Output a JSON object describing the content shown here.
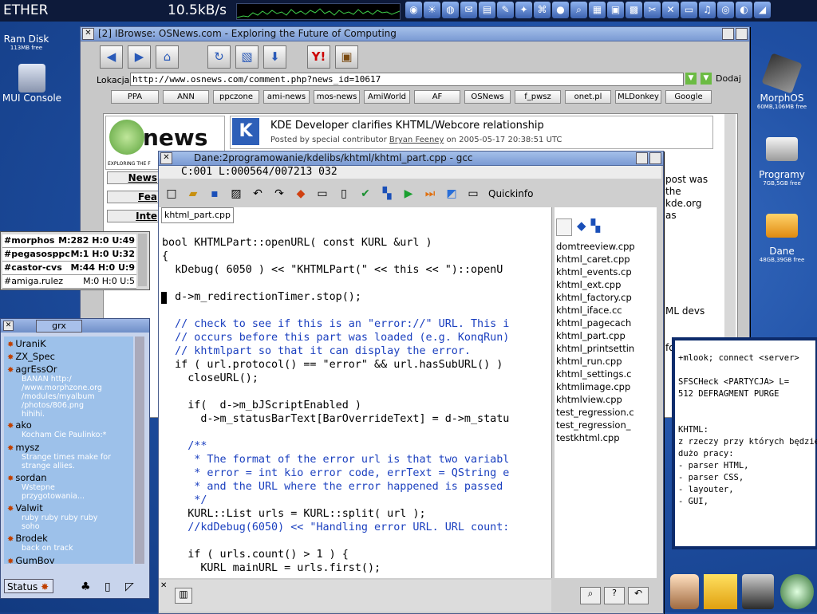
{
  "topbar": {
    "app_name": "ETHER",
    "rate": "10.5kB/s",
    "dock_icons": [
      "world-icon",
      "sun-icon",
      "globe-icon",
      "mail-icon",
      "note-icon",
      "paint-icon",
      "wand-icon",
      "net-icon",
      "bullet-icon",
      "magnifier-icon",
      "doc-icon",
      "calendar-icon",
      "image-icon",
      "tool-icon",
      "scissors-icon",
      "display-icon",
      "bell-icon",
      "disc-icon",
      "cd-icon",
      "flag-icon"
    ]
  },
  "desktop": {
    "ramdisk": {
      "label": "Ram Disk",
      "sub": "113MB free"
    },
    "mui": {
      "label": "MUI Console"
    },
    "morphos": {
      "label": "MorphOS",
      "sub": "60MB,106MB free"
    },
    "programy": {
      "label": "Programy",
      "sub": "7GB,5GB free"
    },
    "dane": {
      "label": "Dane",
      "sub": "48GB,39GB free"
    }
  },
  "ibrowse": {
    "title": "[2] IBrowse: OSNews.com - Exploring the Future of Computing",
    "location_label": "Lokacja:",
    "url": "http://www.osnews.com/comment.php?news_id=10617",
    "add_label": "Dodaj",
    "bookmarks": [
      "PPA",
      "ANN",
      "ppczone",
      "ami-news",
      "mos-news",
      "AmiWorld",
      "AF",
      "OSNews",
      "f_pwsz",
      "onet.pl",
      "MLDonkey",
      "Google"
    ],
    "headline": "KDE Developer clarifies KHTML/Webcore relationship",
    "posted_prefix": "Posted by special contributor",
    "author": "Bryan Feeney",
    "posted_suffix": "on 2005-05-17 20:38:51 UTC",
    "side_links": [
      "News",
      "Fea",
      "Inte"
    ],
    "logo_text": "news",
    "logo_tagline": "EXPLORING THE F",
    "snippet_lines": [
      "post was",
      "the",
      "kde.org",
      "as"
    ],
    "right_frag": [
      "ML devs",
      "for the"
    ]
  },
  "editor": {
    "title": "Dane:2programowanie/kdelibs/khtml/khtml_part.cpp  -  gcc",
    "status": "C:001 L:000564/007213 032",
    "quickinfo": "Quickinfo",
    "tab": "khtml_part.cpp",
    "code": [
      "bool KHTMLPart::openURL( const KURL &url )",
      "{",
      "  kDebug( 6050 ) << \"KHTMLPart(\" << this << \")::openU",
      "",
      "  d->m_redirectionTimer.stop();",
      "",
      "  // check to see if this is an \"error://\" URL. This i",
      "  // occurs before this part was loaded (e.g. KonqRun)",
      "  // khtmlpart so that it can display the error.",
      "  if ( url.protocol() == \"error\" && url.hasSubURL() )",
      "    closeURL();",
      "",
      "    if(  d->m_bJScriptEnabled )",
      "      d->m_statusBarText[BarOverrideText] = d->m_statu",
      "",
      "    /**",
      "     * The format of the error url is that two variabl",
      "     * error = int kio error code, errText = QString e",
      "     * and the URL where the error happened is passed",
      "     */",
      "    KURL::List urls = KURL::split( url );",
      "    //kdDebug(6050) << \"Handling error URL. URL count:",
      "",
      "    if ( urls.count() > 1 ) {",
      "      KURL mainURL = urls.first();"
    ],
    "files": [
      "domtreeview.cpp",
      "khtml_caret.cpp",
      "khtml_events.cp",
      "khtml_ext.cpp",
      "khtml_factory.cp",
      "khtml_iface.cc",
      "khtml_pagecach",
      "khtml_part.cpp",
      "khtml_printsettin",
      "khtml_run.cpp",
      "khtml_settings.c",
      "khtmlimage.cpp",
      "khtmlview.cpp",
      "test_regression.c",
      "test_regression_",
      "testkhtml.cpp"
    ]
  },
  "channels": [
    {
      "name": "#morphos",
      "counts": "M:282 H:0 U:49"
    },
    {
      "name": "#pegasosppc",
      "counts": "M:1 H:0 U:32"
    },
    {
      "name": "#castor-cvs",
      "counts": "M:44 H:0 U:9"
    },
    {
      "name": "#amiga.rulez",
      "counts": "M:0 H:0 U:5"
    }
  ],
  "grx": {
    "title": "grx",
    "status_label": "Status",
    "users": [
      {
        "nick": "UraniK",
        "msg": []
      },
      {
        "nick": "ZX_Spec",
        "msg": []
      },
      {
        "nick": "agrEssOr",
        "msg": [
          "BANAN http:/",
          "/www.morphzone.org",
          "/modules/myalbum",
          "/photos/806.png",
          "hihihi."
        ]
      },
      {
        "nick": "ako",
        "msg": [
          "Kocham Cie Paulinko:*"
        ]
      },
      {
        "nick": "mysz",
        "msg": [
          "Strange times make for",
          "strange allies."
        ]
      },
      {
        "nick": "sordan",
        "msg": [
          "Wstepne",
          "przygotowania..."
        ]
      },
      {
        "nick": "Valwit",
        "msg": [
          "ruby ruby ruby ruby",
          "soho"
        ]
      },
      {
        "nick": "Brodek",
        "msg": [
          "back on track"
        ]
      },
      {
        "nick": "GumBoy",
        "msg": []
      }
    ]
  },
  "notes": {
    "lines": [
      "+mlook; connect <server>",
      "",
      "SFSCHeck <PARTYCJA> L=",
      "512 DEFRAGMENT PURGE",
      "",
      "",
      "KHTML:",
      "z rzeczy przy których będzie",
      "dużo pracy:",
      "- parser HTML,",
      "- parser CSS,",
      "- layouter,",
      "- GUI,"
    ]
  },
  "colors": {
    "desktop": "#1f4fa3",
    "comment": "#1a3fbf",
    "string": "#c01010"
  }
}
